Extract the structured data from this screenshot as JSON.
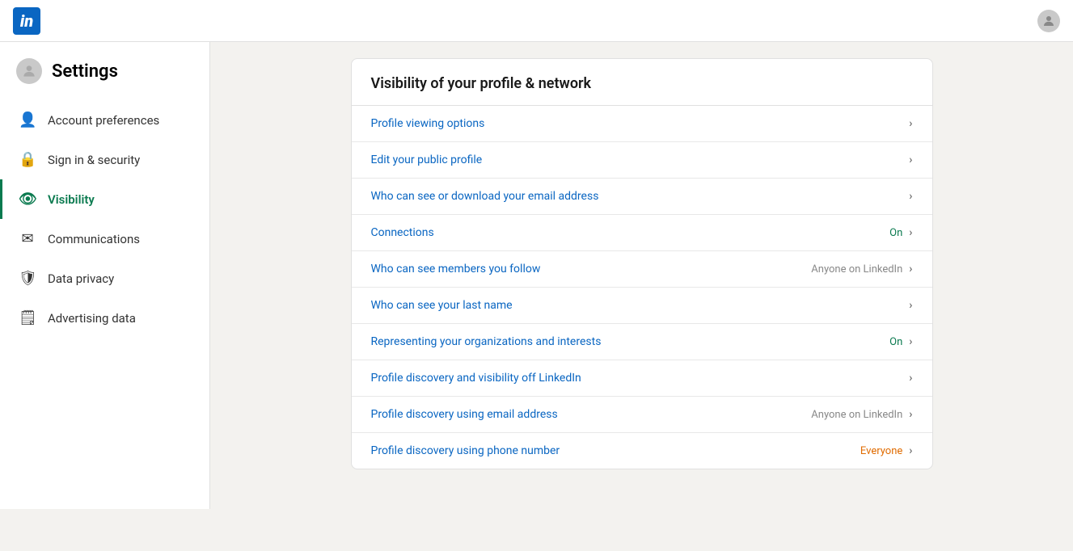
{
  "topnav": {
    "logo_text": "in"
  },
  "sidebar": {
    "settings_label": "Settings",
    "items": [
      {
        "id": "account-preferences",
        "label": "Account preferences",
        "icon": "👤",
        "active": false
      },
      {
        "id": "sign-in-security",
        "label": "Sign in & security",
        "icon": "🔒",
        "active": false
      },
      {
        "id": "visibility",
        "label": "Visibility",
        "icon": "👁",
        "active": true
      },
      {
        "id": "communications",
        "label": "Communications",
        "icon": "✉",
        "active": false
      },
      {
        "id": "data-privacy",
        "label": "Data privacy",
        "icon": "🛡",
        "active": false
      },
      {
        "id": "advertising-data",
        "label": "Advertising data",
        "icon": "🗒",
        "active": false
      }
    ]
  },
  "main": {
    "section_title": "Visibility of your profile & network",
    "items": [
      {
        "label": "Profile viewing options",
        "status": "",
        "status_class": ""
      },
      {
        "label": "Edit your public profile",
        "status": "",
        "status_class": ""
      },
      {
        "label": "Who can see or download your email address",
        "status": "",
        "status_class": ""
      },
      {
        "label": "Connections",
        "status": "On",
        "status_class": "green"
      },
      {
        "label": "Who can see members you follow",
        "status": "Anyone on LinkedIn",
        "status_class": ""
      },
      {
        "label": "Who can see your last name",
        "status": "",
        "status_class": ""
      },
      {
        "label": "Representing your organizations and interests",
        "status": "On",
        "status_class": "green"
      },
      {
        "label": "Profile discovery and visibility off LinkedIn",
        "status": "",
        "status_class": ""
      },
      {
        "label": "Profile discovery using email address",
        "status": "Anyone on LinkedIn",
        "status_class": ""
      },
      {
        "label": "Profile discovery using phone number",
        "status": "Everyone",
        "status_class": "orange"
      }
    ]
  }
}
